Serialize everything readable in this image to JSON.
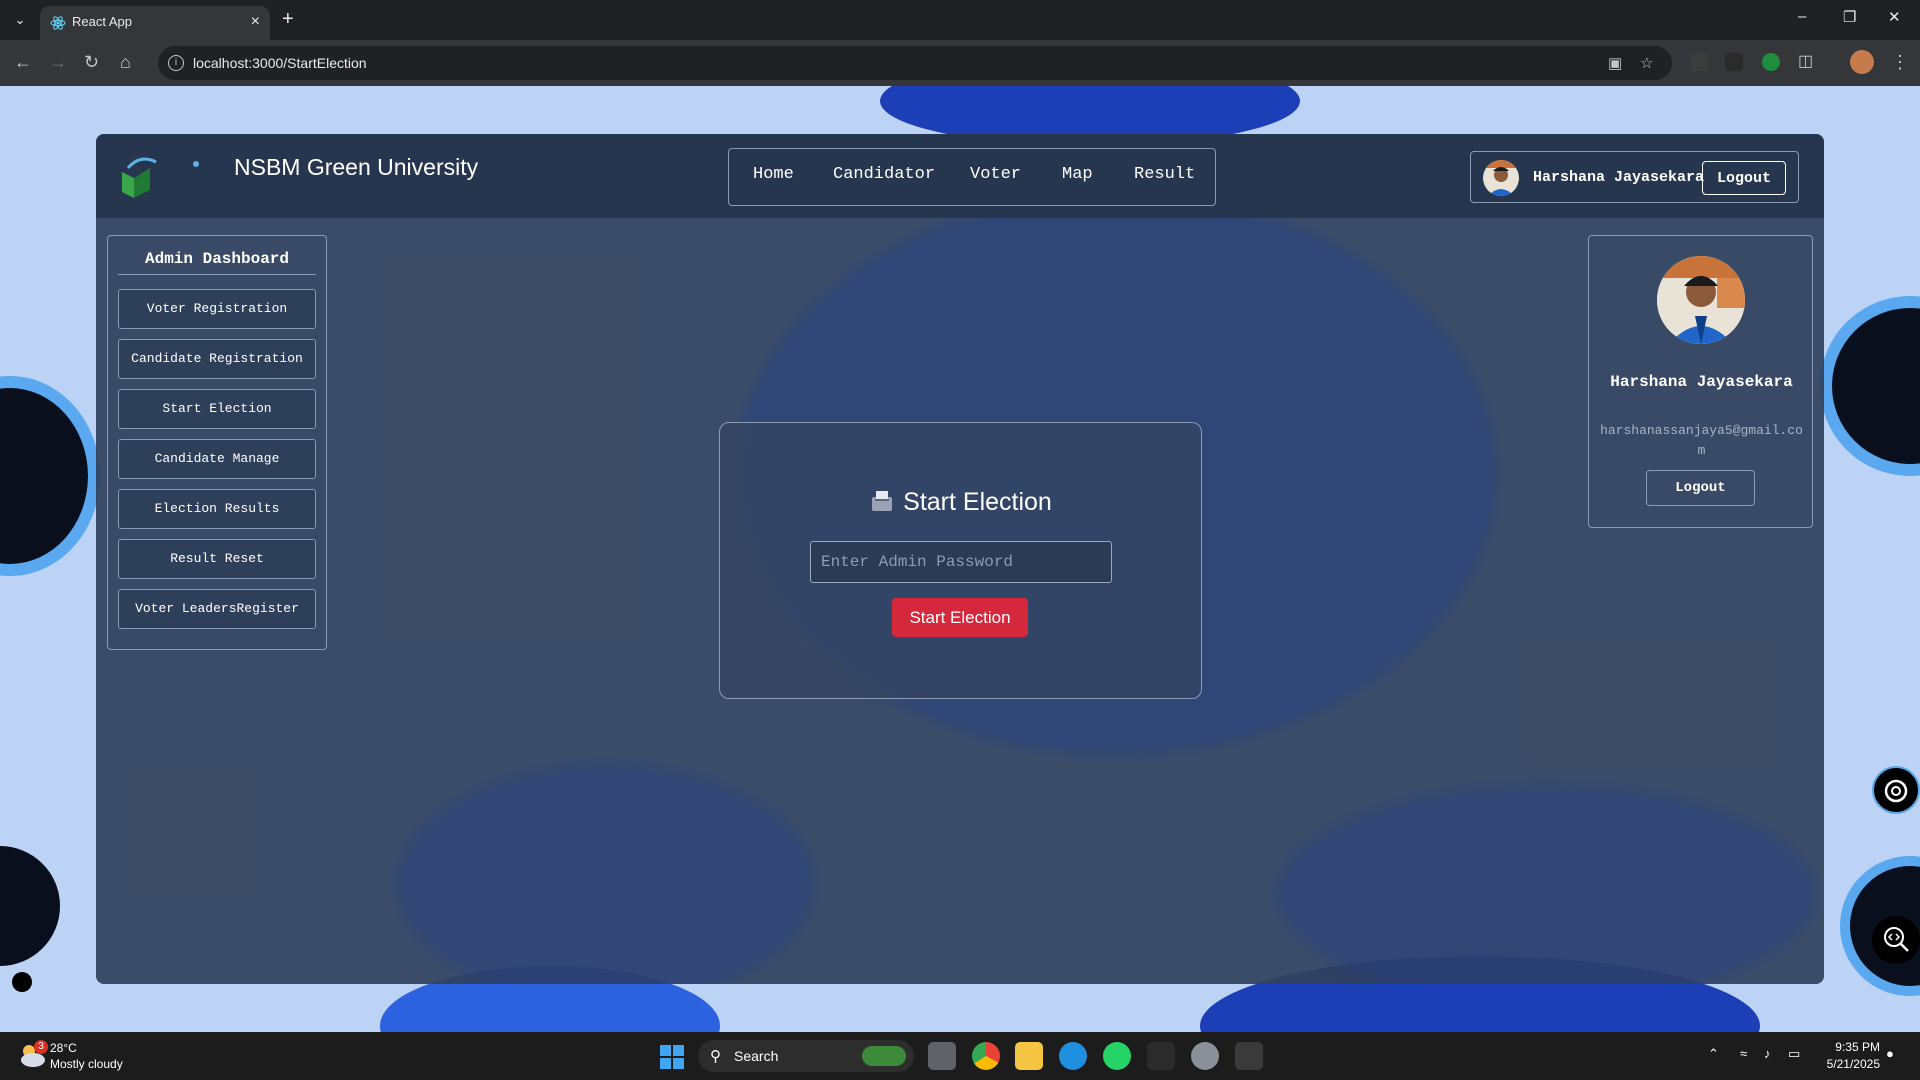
{
  "browser": {
    "tab_title": "React App",
    "url": "localhost:3000/StartElection"
  },
  "header": {
    "brand": "NSBM Green University",
    "nav": [
      "Home",
      "Candidator",
      "Voter",
      "Map",
      "Result"
    ],
    "user_name": "Harshana Jayasekara",
    "logout_label": "Logout"
  },
  "sidebar": {
    "title": "Admin Dashboard",
    "items": [
      {
        "label": "Voter Registration"
      },
      {
        "label": "Candidate Registration"
      },
      {
        "label": "Start Election"
      },
      {
        "label": "Candidate Manage"
      },
      {
        "label": "Election Results"
      },
      {
        "label": "Result Reset"
      },
      {
        "label": "Voter LeadersRegister"
      }
    ]
  },
  "main": {
    "title": "Start Election",
    "password_placeholder": "Enter Admin Password",
    "password_value": "",
    "submit_label": "Start Election",
    "submit_color": "#d5283c"
  },
  "profile": {
    "name": "Harshana Jayasekara",
    "email": "harshanassanjaya5@gmail.com",
    "logout_label": "Logout"
  },
  "taskbar": {
    "weather_temp": "28°C",
    "weather_desc": "Mostly cloudy",
    "weather_badge": "3",
    "search_label": "Search",
    "time": "9:35 PM",
    "date": "5/21/2025"
  }
}
